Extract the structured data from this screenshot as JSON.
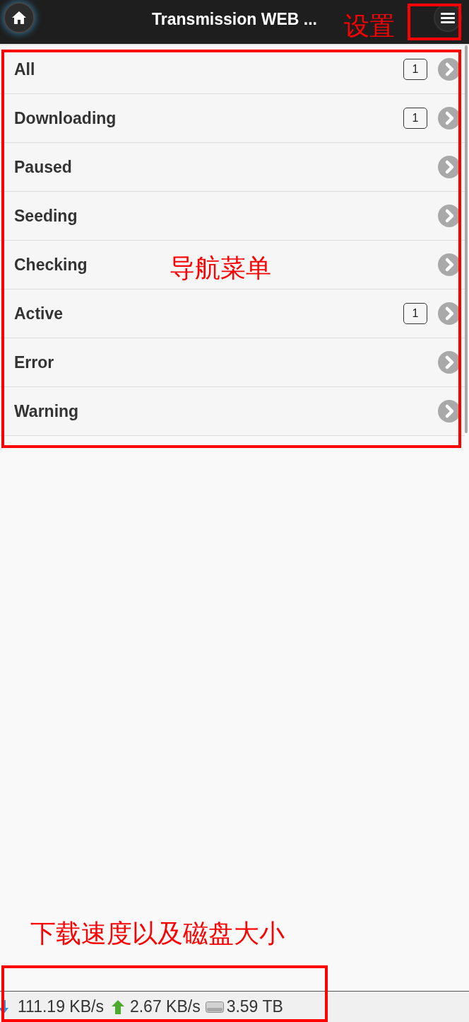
{
  "header": {
    "title": "Transmission WEB ...",
    "annotation": "设置"
  },
  "nav_menu": {
    "annotation": "导航菜单",
    "items": [
      {
        "label": "All",
        "count": "1"
      },
      {
        "label": "Downloading",
        "count": "1"
      },
      {
        "label": "Paused"
      },
      {
        "label": "Seeding"
      },
      {
        "label": "Checking"
      },
      {
        "label": "Active",
        "count": "1"
      },
      {
        "label": "Error"
      },
      {
        "label": "Warning"
      }
    ]
  },
  "status_bar": {
    "annotation": "下载速度以及磁盘大小",
    "download_speed": "111.19 KB/s",
    "upload_speed": "2.67 KB/s",
    "disk_size": "3.59 TB"
  }
}
